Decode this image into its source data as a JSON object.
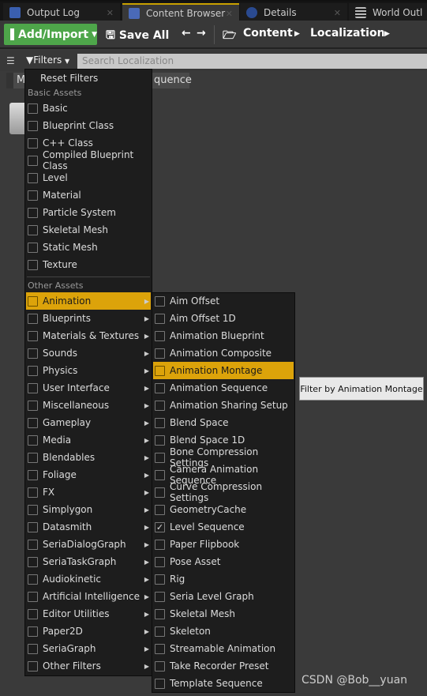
{
  "tabs": [
    {
      "label": "Output Log",
      "icon": "output-log-icon"
    },
    {
      "label": "Content Browser",
      "icon": "content-browser-icon",
      "active": true
    },
    {
      "label": "Details",
      "icon": "details-icon"
    },
    {
      "label": "World Outl",
      "icon": "world-outliner-icon"
    }
  ],
  "toolbar": {
    "add_import": "Add/Import",
    "save_all": "Save All",
    "path": [
      "Content",
      "Localization"
    ]
  },
  "filters": {
    "label": "Filters",
    "search_placeholder": "Search Localization"
  },
  "chip": {
    "prefix": "M",
    "suffix": "quence"
  },
  "menu": {
    "reset": "Reset Filters",
    "basic_header": "Basic Assets",
    "basic": [
      "Basic",
      "Blueprint Class",
      "C++ Class",
      "Compiled Blueprint Class",
      "Level",
      "Material",
      "Particle System",
      "Skeletal Mesh",
      "Static Mesh",
      "Texture"
    ],
    "other_header": "Other Assets",
    "other": [
      "Animation",
      "Blueprints",
      "Materials & Textures",
      "Sounds",
      "Physics",
      "User Interface",
      "Miscellaneous",
      "Gameplay",
      "Media",
      "Blendables",
      "Foliage",
      "FX",
      "Simplygon",
      "Datasmith",
      "SeriaDialogGraph",
      "SeriaTaskGraph",
      "Audiokinetic",
      "Artificial Intelligence",
      "Editor Utilities",
      "Paper2D",
      "SeriaGraph",
      "Other Filters"
    ],
    "highlighted": "Animation"
  },
  "submenu": {
    "items": [
      "Aim Offset",
      "Aim Offset 1D",
      "Animation Blueprint",
      "Animation Composite",
      "Animation Montage",
      "Animation Sequence",
      "Animation Sharing Setup",
      "Blend Space",
      "Blend Space 1D",
      "Bone Compression Settings",
      "Camera Animation Sequence",
      "Curve Compression Settings",
      "GeometryCache",
      "Level Sequence",
      "Paper Flipbook",
      "Pose Asset",
      "Rig",
      "Seria Level Graph",
      "Skeletal Mesh",
      "Skeleton",
      "Streamable Animation",
      "Take Recorder Preset",
      "Template Sequence"
    ],
    "checked": [
      "Level Sequence"
    ],
    "highlighted": "Animation Montage"
  },
  "tooltip": "Filter by Animation Montage",
  "watermark": "CSDN @Bob__yuan",
  "colors": {
    "accent": "#dca30a",
    "add_button": "#4ea64a"
  }
}
